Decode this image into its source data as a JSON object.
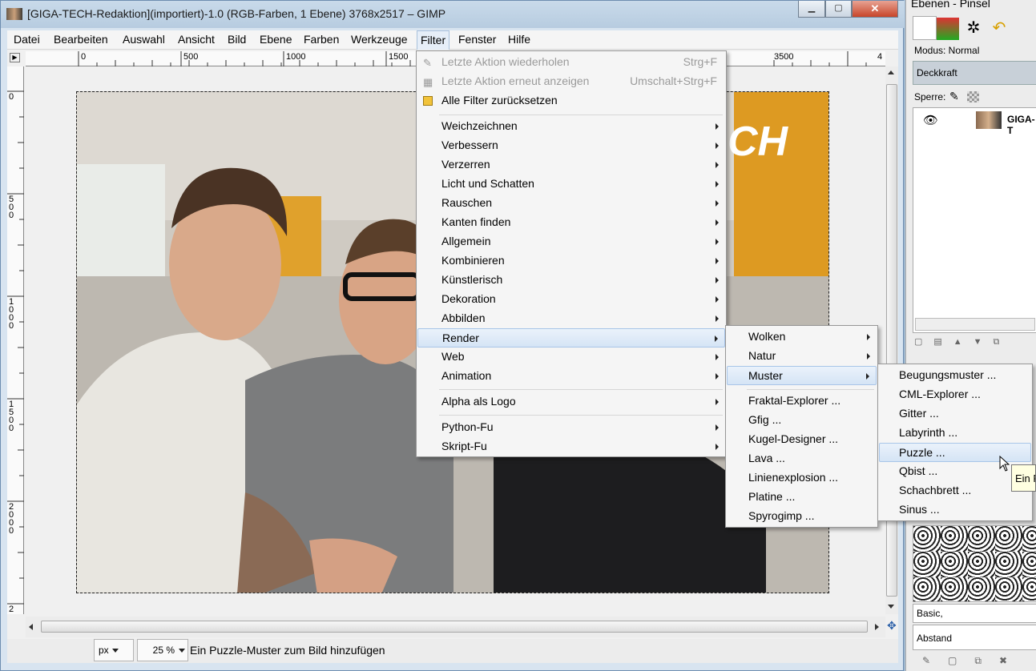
{
  "window": {
    "title": "[GIGA-TECH-Redaktion](importiert)-1.0 (RGB-Farben, 1 Ebene) 3768x2517 – GIMP",
    "min": "▁",
    "max": "▢",
    "close": "✕"
  },
  "menubar": [
    "Datei",
    "Bearbeiten",
    "Auswahl",
    "Ansicht",
    "Bild",
    "Ebene",
    "Farben",
    "Werkzeuge",
    "Filter",
    "Fenster",
    "Hilfe"
  ],
  "ruler": {
    "h_labels": [
      "0",
      "500",
      "1000",
      "1500",
      "3500",
      "4"
    ],
    "v_labels": [
      "0",
      "500",
      "1000",
      "1500",
      "2000",
      "2"
    ]
  },
  "photo": {
    "logo_text": "CH"
  },
  "filter_menu": {
    "top": [
      {
        "label": "Letzte Aktion wiederholen",
        "shortcut": "Strg+F"
      },
      {
        "label": "Letzte Aktion erneut anzeigen",
        "shortcut": "Umschalt+Strg+F"
      },
      {
        "label": "Alle Filter zurücksetzen"
      }
    ],
    "groups": [
      "Weichzeichnen",
      "Verbessern",
      "Verzerren",
      "Licht und Schatten",
      "Rauschen",
      "Kanten finden",
      "Allgemein",
      "Kombinieren",
      "Künstlerisch",
      "Dekoration",
      "Abbilden",
      "Render",
      "Web",
      "Animation"
    ],
    "logo": "Alpha als Logo",
    "scripts": [
      "Python-Fu",
      "Skript-Fu"
    ]
  },
  "render_menu": {
    "sub": [
      "Wolken",
      "Natur",
      "Muster"
    ],
    "items": [
      "Fraktal-Explorer ...",
      "Gfig ...",
      "Kugel-Designer ...",
      "Lava ...",
      "Linienexplosion ...",
      "Platine ...",
      "Spyrogimp ..."
    ]
  },
  "muster_menu": [
    "Beugungsmuster ...",
    "CML-Explorer ...",
    "Gitter ...",
    "Labyrinth ...",
    "Puzzle ...",
    "Qbist ...",
    "Schachbrett ...",
    "Sinus ..."
  ],
  "tooltip": "Ein P",
  "statusbar": {
    "unit": "px",
    "zoom": "25 %",
    "message": "Ein Puzzle-Muster zum Bild hinzufügen"
  },
  "dock": {
    "title": "Ebenen - Pinsel",
    "mode_label": "Modus: Normal",
    "opacity_label": "Deckkraft",
    "lock_label": "Sperre:",
    "layer_name": "GIGA-T",
    "brush_set": "Basic,",
    "spacing_label": "Abstand"
  }
}
